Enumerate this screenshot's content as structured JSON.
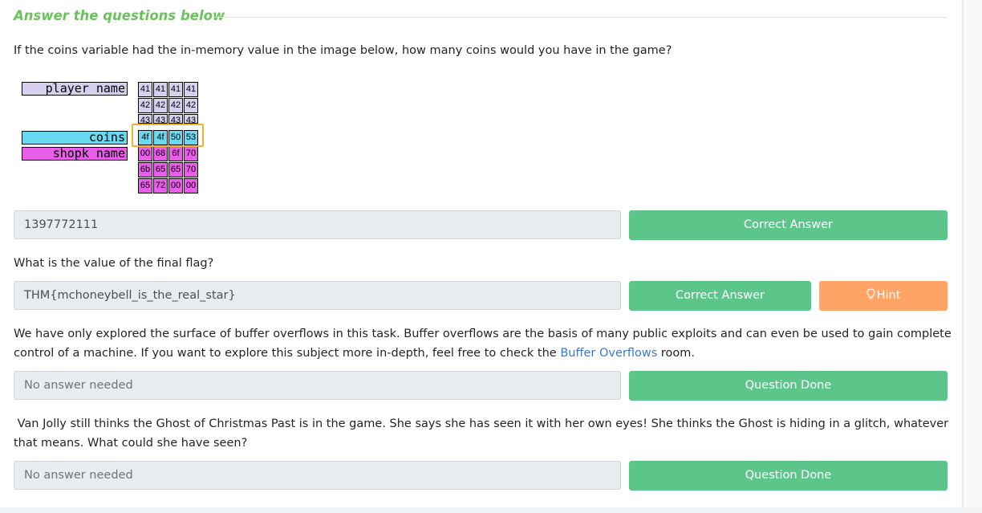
{
  "section": {
    "title": "Answer the questions below"
  },
  "colors": {
    "title": "#6ac25a",
    "button_green": "#5cc58a",
    "button_orange": "#ffa466",
    "field_bg": "#e9ecef",
    "link": "#3a78d6",
    "mem_blue": "#6ad8ee",
    "mem_pink": "#e85ee8",
    "mem_lavender": "#d6d0ee",
    "highlight": "#efb42b"
  },
  "questions": [
    {
      "text": "If the coins variable had the in-memory value in the image below, how many coins would you have in the game?",
      "answer": "1397772111",
      "button": "Correct Answer"
    },
    {
      "text": "What is the value of the final flag?",
      "answer": "THM{mchoneybell_is_the_real_star}",
      "button": "Correct Answer",
      "hint_button": "Hint",
      "hint_icon": "lightbulb-icon"
    },
    {
      "text_before_link": "We have only explored the surface of buffer overflows in this task. Buffer overflows are the basis of many public exploits and can even be used to gain complete control of a machine. If you want to explore this subject more in-depth, feel free to check the ",
      "link_text": "Buffer Overflows",
      "text_after_link": " room.",
      "answer_placeholder": "No answer needed",
      "button": "Question Done"
    },
    {
      "text": " Van Jolly still thinks the Ghost of Christmas Past is in the game. She says she has seen it with her own eyes! She thinks the Ghost is hiding in a glitch, whatever that means. What could she have seen?",
      "answer_placeholder": "No answer needed",
      "button": "Question Done"
    }
  ],
  "memory_diagram": {
    "variables": [
      "player_name",
      "coins",
      "shopk_name"
    ],
    "rows": [
      [
        "41",
        "41",
        "41",
        "41"
      ],
      [
        "42",
        "42",
        "42",
        "42"
      ],
      [
        "43",
        "43",
        "43",
        "43"
      ],
      [
        "4f",
        "4f",
        "50",
        "53"
      ],
      [
        "00",
        "68",
        "6f",
        "70"
      ],
      [
        "6b",
        "65",
        "65",
        "70"
      ],
      [
        "65",
        "72",
        "00",
        "00"
      ]
    ]
  }
}
